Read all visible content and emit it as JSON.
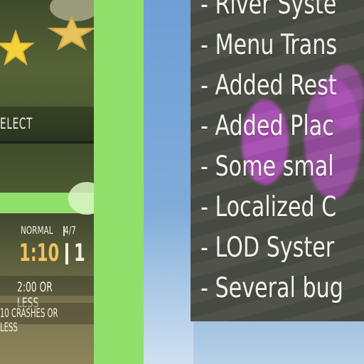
{
  "game": {
    "menu_label": "ELECT",
    "difficulty": "NORMAL",
    "level_progress": "4/7",
    "timer": "1:10",
    "counter": "1",
    "condition_time": "2:00 OR LESS",
    "condition_crashes": "10 CRASHES OR LESS"
  },
  "changelog": {
    "items": [
      "- River Syste",
      "- Menu Trans",
      "- Added Rest",
      "- Added Plac",
      "- Some smal",
      "- Localized C",
      "- LOD Syster",
      "- Several bug"
    ]
  },
  "colors": {
    "green_separator": "#91e06b",
    "panel_background": "#4a4d44",
    "timer_color": "#f0c35a",
    "sky": "#7aa6d6"
  },
  "icons": [
    "star-icon"
  ]
}
